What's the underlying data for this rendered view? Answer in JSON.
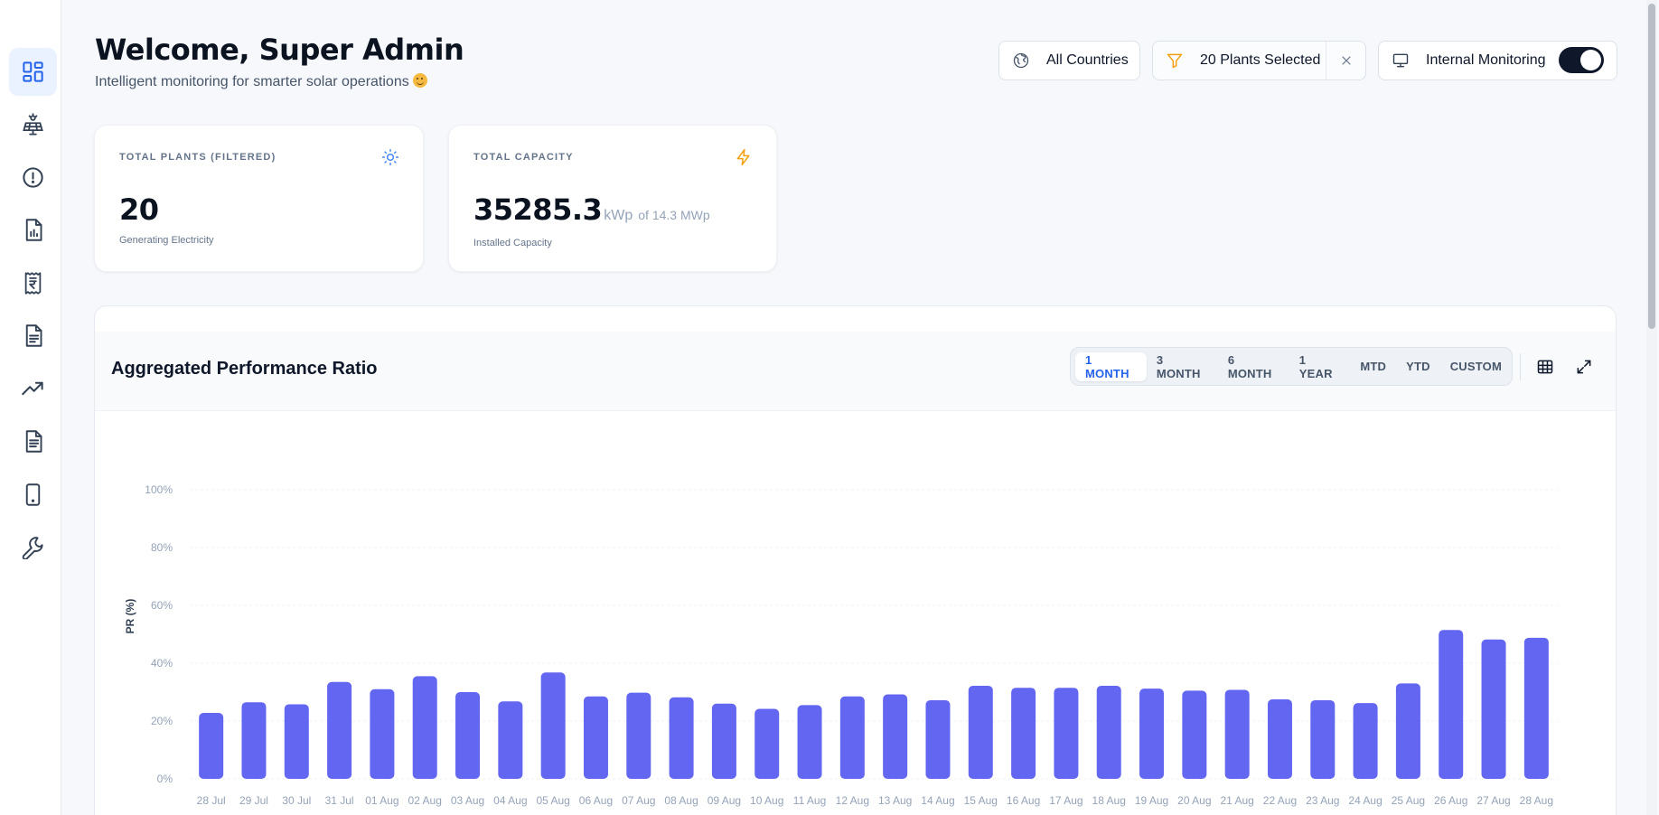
{
  "header": {
    "welcome": "Welcome, Super Admin",
    "subtitle": "Intelligent monitoring for smarter solar operations",
    "countries_label": "All Countries",
    "plants_label": "20 Plants Selected",
    "monitoring_label": "Internal Monitoring",
    "monitoring_on": true
  },
  "sidebar": {
    "items": [
      {
        "icon": "dashboard-icon",
        "active": true
      },
      {
        "icon": "solar-panel-icon",
        "active": false
      },
      {
        "icon": "alert-circle-icon",
        "active": false
      },
      {
        "icon": "report-chart-icon",
        "active": false
      },
      {
        "icon": "rupee-receipt-icon",
        "active": false
      },
      {
        "icon": "document-icon",
        "active": false
      },
      {
        "icon": "trending-up-icon",
        "active": false
      },
      {
        "icon": "document-list-icon",
        "active": false
      },
      {
        "icon": "mobile-icon",
        "active": false
      },
      {
        "icon": "wrench-icon",
        "active": false
      }
    ]
  },
  "cards": {
    "total_plants": {
      "label": "TOTAL PLANTS (FILTERED)",
      "value": "20",
      "desc": "Generating Electricity",
      "icon": "sun-icon"
    },
    "total_capacity": {
      "label": "TOTAL CAPACITY",
      "value": "35285.3",
      "unit": "kWp",
      "of": "of 14.3 MWp",
      "desc": "Installed Capacity",
      "icon": "lightning-icon"
    }
  },
  "chart_panel": {
    "title": "Aggregated Performance Ratio",
    "ranges": [
      "1 MONTH",
      "3 MONTH",
      "6 MONTH",
      "1 YEAR",
      "MTD",
      "YTD",
      "CUSTOM"
    ],
    "active_range": "1 MONTH"
  },
  "colors": {
    "accent": "#2563eb",
    "bar": "#6366f1",
    "lightning": "#f59e0b"
  },
  "chart_data": {
    "type": "bar",
    "ylabel": "PR (%)",
    "ylim": [
      0,
      100
    ],
    "yticks": [
      "0%",
      "20%",
      "40%",
      "60%",
      "80%",
      "100%"
    ],
    "categories": [
      "28 Jul",
      "29 Jul",
      "30 Jul",
      "31 Jul",
      "01 Aug",
      "02 Aug",
      "03 Aug",
      "04 Aug",
      "05 Aug",
      "06 Aug",
      "07 Aug",
      "08 Aug",
      "09 Aug",
      "10 Aug",
      "11 Aug",
      "12 Aug",
      "13 Aug",
      "14 Aug",
      "15 Aug",
      "16 Aug",
      "17 Aug",
      "18 Aug",
      "19 Aug",
      "20 Aug",
      "21 Aug",
      "22 Aug",
      "23 Aug",
      "24 Aug",
      "25 Aug",
      "26 Aug",
      "27 Aug",
      "28 Aug"
    ],
    "values": [
      22.8,
      26.5,
      25.8,
      33.5,
      31.0,
      35.5,
      30.0,
      26.8,
      36.8,
      28.5,
      29.8,
      28.2,
      26.0,
      24.2,
      25.5,
      28.5,
      29.2,
      27.2,
      32.2,
      31.5,
      31.5,
      32.2,
      31.2,
      30.5,
      30.8,
      27.5,
      27.2,
      26.2,
      33.0,
      51.5,
      48.2,
      48.8
    ],
    "grid": true,
    "legend": "none"
  }
}
